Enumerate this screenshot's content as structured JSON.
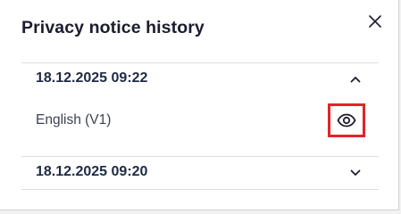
{
  "dialog": {
    "title": "Privacy notice history",
    "close_icon": "close-icon"
  },
  "entries": [
    {
      "date": "18.12.2025 09:22",
      "expanded": true,
      "chevron_icon": "chevron-up-icon",
      "versions": [
        {
          "label": "English (V1)",
          "action_icon": "eye-icon"
        }
      ]
    },
    {
      "date": "18.12.2025 09:20",
      "expanded": false,
      "chevron_icon": "chevron-down-icon"
    }
  ],
  "colors": {
    "highlight": "#e2242b",
    "title": "#1c1c2e",
    "date_text": "#1f2a44",
    "body_text": "#3c4250",
    "divider": "#dcdcdc"
  }
}
